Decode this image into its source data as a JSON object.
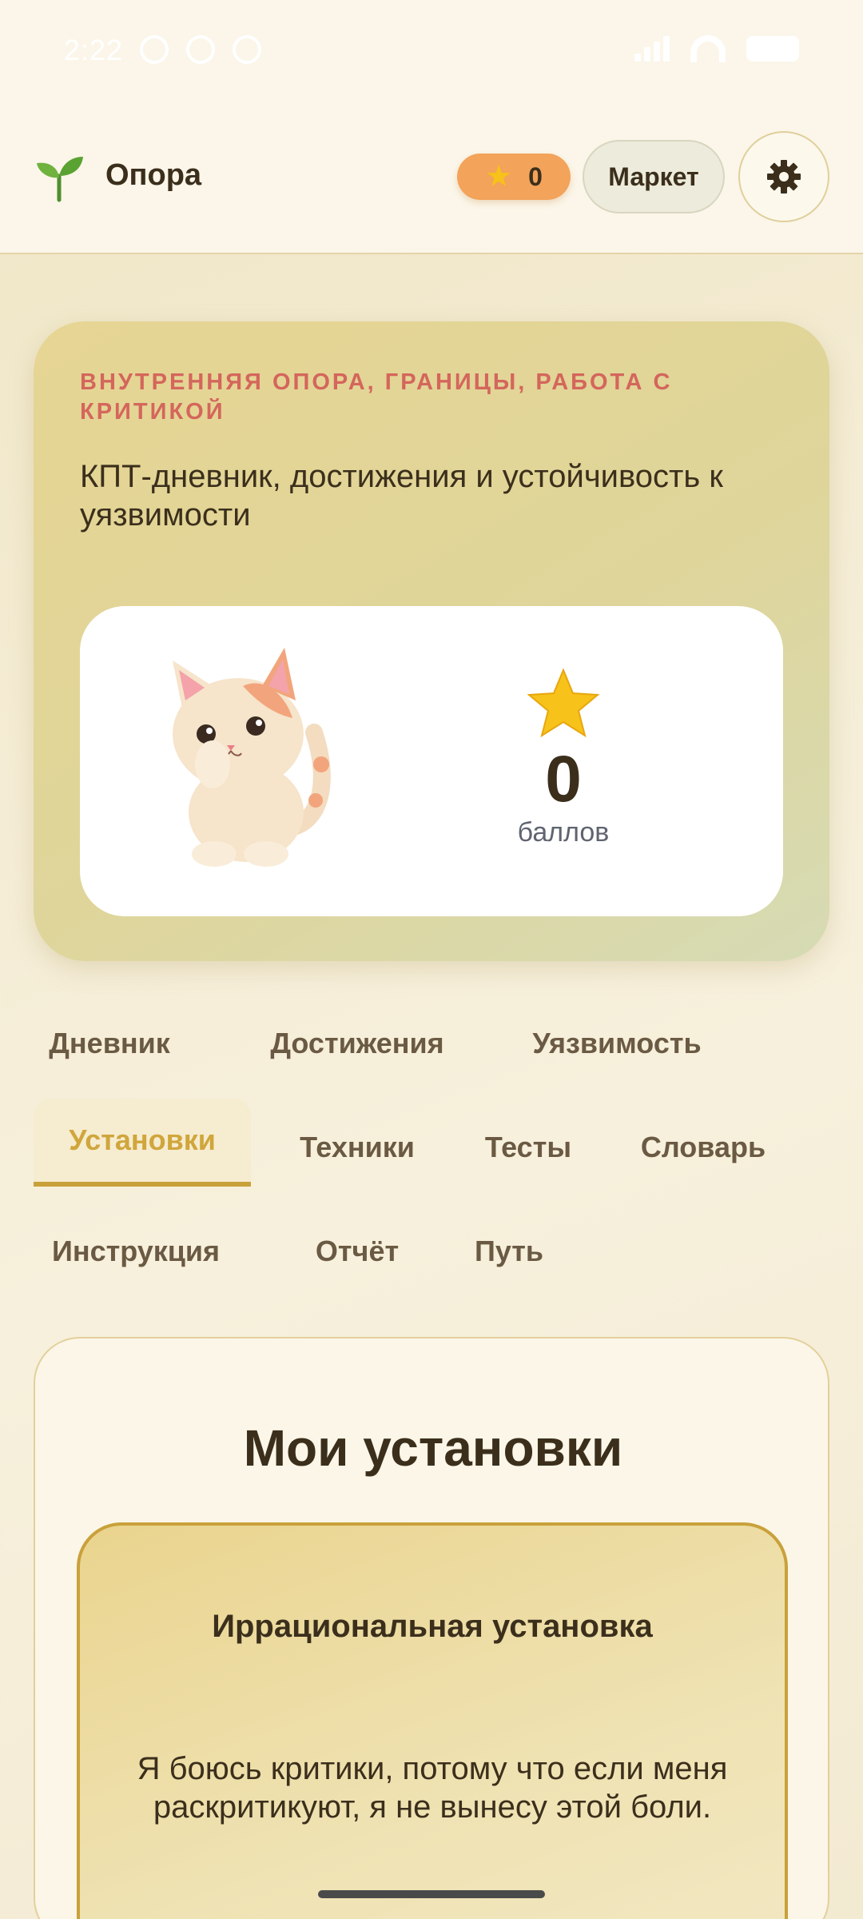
{
  "status_bar": {
    "time": "2:22"
  },
  "header": {
    "app_title": "Опора",
    "stars_count": "0",
    "market_label": "Маркет"
  },
  "hero": {
    "topic": "ВНУТРЕННЯЯ ОПОРА, ГРАНИЦЫ, РАБОТА С КРИТИКОЙ",
    "description": "КПТ-дневник, достижения и устойчивость к уязвимости",
    "score_value": "0",
    "score_label": "баллов"
  },
  "tabs": [
    {
      "label": "Дневник",
      "active": false
    },
    {
      "label": "Достижения",
      "active": false
    },
    {
      "label": "Уязвимость",
      "active": false
    },
    {
      "label": "Установки",
      "active": true
    },
    {
      "label": "Техники",
      "active": false
    },
    {
      "label": "Тесты",
      "active": false
    },
    {
      "label": "Словарь",
      "active": false
    },
    {
      "label": "Инструкция",
      "active": false
    },
    {
      "label": "Отчёт",
      "active": false
    },
    {
      "label": "Путь",
      "active": false
    }
  ],
  "content": {
    "title": "Мои установки",
    "belief_heading": "Иррациональная установка",
    "belief_text": "Я боюсь критики, потому что если меня раскритикуют, я не вынесу этой боли."
  },
  "colors": {
    "accent": "#c9a13a",
    "topic": "#d4665c",
    "stars_pill": "#f3a35a"
  },
  "icons": [
    "sprout-icon",
    "star-icon",
    "gear-icon",
    "cat-mascot"
  ]
}
